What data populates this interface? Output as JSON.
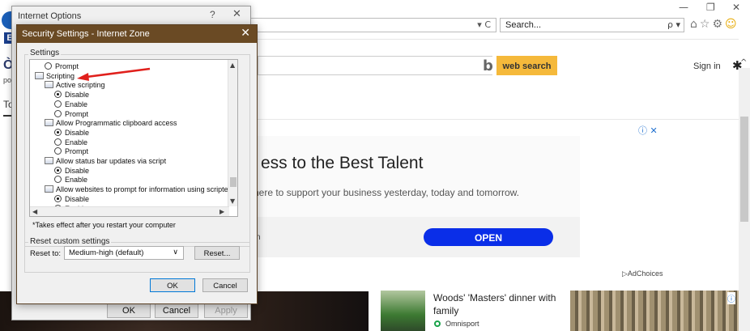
{
  "browser": {
    "search_placeholder": "Search...",
    "addr_icons": "▾ C",
    "search_drop": "ρ ▾",
    "win_controls": [
      "—",
      "❐",
      "✕"
    ],
    "toolbar_icons": [
      "⌂",
      "☆",
      "⚙",
      "☺"
    ]
  },
  "page": {
    "web_search_label": "web search",
    "sign_in": "Sign in",
    "ad": {
      "title": "ess to the Best Talent",
      "subtitle": "here to support your business yesterday, today and tomorrow.",
      "brand": "n",
      "open_label": "OPEN",
      "adchoices": "AdChoices",
      "info_icons": "ⓘ ✕"
    },
    "news": {
      "title": "Woods' 'Masters' dinner with family",
      "source": "Omnisport"
    },
    "left_fragments": {
      "po": "po",
      "to": "To"
    }
  },
  "internet_options": {
    "title": "Internet Options",
    "help": "?",
    "close": "✕",
    "buttons": {
      "ok": "OK",
      "cancel": "Cancel",
      "apply": "Apply"
    }
  },
  "security_settings": {
    "title": "Security Settings - Internet Zone",
    "close": "✕",
    "settings_group": "Settings",
    "tree": [
      {
        "type": "radio",
        "label": "Prompt",
        "checked": false,
        "indent": 1
      },
      {
        "type": "category",
        "label": "Scripting",
        "indent": 0
      },
      {
        "type": "category",
        "label": "Active scripting",
        "indent": 1
      },
      {
        "type": "radio",
        "label": "Disable",
        "checked": true,
        "indent": 2
      },
      {
        "type": "radio",
        "label": "Enable",
        "checked": false,
        "indent": 2
      },
      {
        "type": "radio",
        "label": "Prompt",
        "checked": false,
        "indent": 2
      },
      {
        "type": "category",
        "label": "Allow Programmatic clipboard access",
        "indent": 1
      },
      {
        "type": "radio",
        "label": "Disable",
        "checked": true,
        "indent": 2
      },
      {
        "type": "radio",
        "label": "Enable",
        "checked": false,
        "indent": 2
      },
      {
        "type": "radio",
        "label": "Prompt",
        "checked": false,
        "indent": 2
      },
      {
        "type": "category",
        "label": "Allow status bar updates via script",
        "indent": 1
      },
      {
        "type": "radio",
        "label": "Disable",
        "checked": true,
        "indent": 2
      },
      {
        "type": "radio",
        "label": "Enable",
        "checked": false,
        "indent": 2
      },
      {
        "type": "category",
        "label": "Allow websites to prompt for information using scripted windo",
        "indent": 1
      },
      {
        "type": "radio",
        "label": "Disable",
        "checked": true,
        "indent": 2
      },
      {
        "type": "radio",
        "label": "Enable",
        "checked": false,
        "indent": 2
      }
    ],
    "note": "*Takes effect after you restart your computer",
    "reset_group": "Reset custom settings",
    "reset_to_label": "Reset to:",
    "reset_value": "Medium-high (default)",
    "reset_button": "Reset...",
    "ok": "OK",
    "cancel": "Cancel",
    "colors": {
      "title_bar": "#6a4a24",
      "arrow": "#e0201c"
    }
  }
}
